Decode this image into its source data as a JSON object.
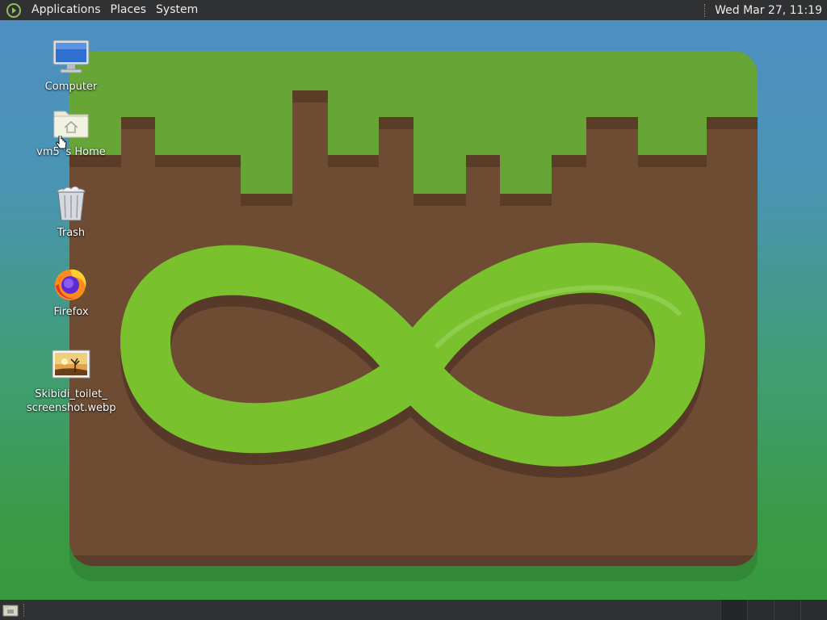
{
  "top_panel": {
    "menus": [
      "Applications",
      "Places",
      "System"
    ],
    "clock": "Wed Mar 27, 11:19"
  },
  "desktop": {
    "icons": [
      {
        "label": "Computer",
        "icon": "computer-monitor-icon"
      },
      {
        "label": "vm5 's Home",
        "icon": "home-folder-icon"
      },
      {
        "label": "Trash",
        "icon": "trash-icon"
      },
      {
        "label": "Firefox",
        "icon": "firefox-icon"
      },
      {
        "label_line1": "Skibidi_toilet_",
        "label_line2": "screenshot.webp",
        "icon": "image-file-icon"
      }
    ]
  },
  "wallpaper": {
    "motif": "grass-block-infinity-icon",
    "colors": {
      "grass": "#66a536",
      "dirt": "#6e4c34",
      "infinity": "#79c22e",
      "shadow": "#57392a"
    }
  },
  "bottom_panel": {
    "workspaces": 4
  }
}
